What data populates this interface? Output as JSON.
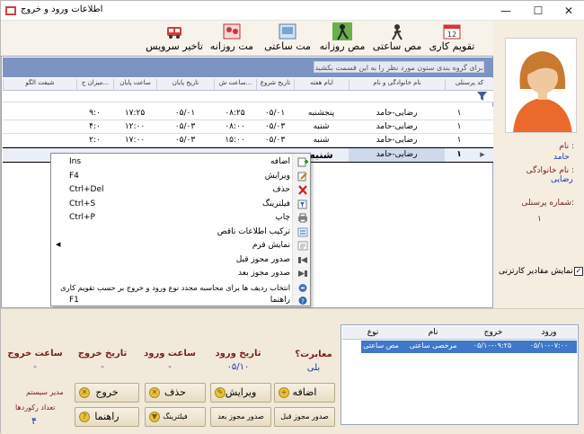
{
  "window": {
    "title": "اطلاعات ورود و خروج",
    "controls": [
      "—",
      "☐",
      "✕"
    ]
  },
  "toolbar": [
    {
      "label": "تقویم کاری",
      "icon": "calendar-icon"
    },
    {
      "label": "مص ساعتی",
      "icon": "hourly-leave-icon"
    },
    {
      "label": "مص روزانه",
      "icon": "daily-leave-icon"
    },
    {
      "label": "مت ساعتی",
      "icon": "hourly-mission-icon"
    },
    {
      "label": "مت روزانه",
      "icon": "daily-mission-icon"
    },
    {
      "label": "تاخیر سرویس",
      "icon": "service-delay-icon"
    }
  ],
  "grid": {
    "group_hint": "برای گروه بندی ستون مورد نظر را به این قسمت بکشید",
    "columns": [
      "کد پرسنلی",
      "نام خانوادگی و نام",
      "ایام هفته",
      "تاریخ شروع",
      "ساعت ش...",
      "تاریخ پایان",
      "ساعت پایان",
      "میزان ج...",
      "شیفت الگو"
    ],
    "rows": [
      [
        "۱",
        "رضایی-حامد",
        "پنجشنبه",
        "۰۵/۰۱",
        "۰۸:۲۵",
        "۰۵/۰۱",
        "۱۷:۲۵",
        "۹:۰",
        ""
      ],
      [
        "۱",
        "رضایی-حامد",
        "شنبه",
        "۰۵/۰۳",
        "۰۸:۰۰",
        "۰۵/۰۳",
        "۱۲:۰۰",
        "۴:۰",
        ""
      ],
      [
        "۱",
        "رضایی-حامد",
        "شنبه",
        "۰۵/۰۳",
        "۱۵:۰۰",
        "۰۵/۰۳",
        "۱۷:۰۰",
        "۲:۰",
        ""
      ],
      [
        "۱",
        "رضایی-حامد",
        "شنبه",
        "",
        "",
        "",
        "",
        "",
        ""
      ]
    ]
  },
  "context_menu": [
    {
      "label": "اضافه",
      "key": "Ins",
      "icon": "add-icon"
    },
    {
      "label": "ویرایش",
      "key": "F4",
      "icon": "edit-icon"
    },
    {
      "label": "حذف",
      "key": "Ctrl+Del",
      "icon": "delete-icon"
    },
    {
      "label": "فیلترینگ",
      "key": "Ctrl+S",
      "icon": "filter-icon"
    },
    {
      "label": "چاپ",
      "key": "Ctrl+P",
      "icon": "print-icon"
    },
    {
      "label": "ترکیب اطلاعات ناقص",
      "key": "",
      "icon": "merge-icon"
    },
    {
      "label": "نمایش فرم",
      "key": "",
      "icon": "form-icon"
    },
    {
      "label": "صدور مجوز قبل",
      "key": "",
      "icon": "prev-permit-icon"
    },
    {
      "label": "صدور مجوز بعد",
      "key": "",
      "icon": "next-permit-icon"
    },
    {
      "label": "انتخاب ردیف ها برای محاسبه مجدد نوع ورود و خروج بر حسب تقویم کاری",
      "key": "",
      "icon": "recalc-icon"
    },
    {
      "label": "راهنما",
      "key": "F1",
      "icon": "help-icon"
    }
  ],
  "person": {
    "name_label": "نام :",
    "name": "حامد",
    "family_label": "نام خانوادگی :",
    "family": "رضایی",
    "code_label": "شماره پرسنلی:",
    "code": "۱",
    "show_char_label": "نمایش مقادیر کارتزنی",
    "show_char_checked": "✓"
  },
  "details": {
    "labels": [
      "معابرت؟",
      "تاریخ ورود",
      "ساعت ورود",
      "تاریخ خروج",
      "ساعت خروج"
    ],
    "values": [
      "بلی",
      "۰۵/۱۰",
      "-",
      "-",
      "-"
    ],
    "user": "مدیر سیستم",
    "record_count_label": "تعداد رکوردها",
    "record_count": "۴"
  },
  "buttons": {
    "add": "اضافه",
    "edit": "ویرایش",
    "delete": "حذف",
    "exit": "خروج",
    "help": "راهنما",
    "filter": "فیلترینگ",
    "next_permit": "صدور مجوز بعد",
    "prev_permit": "صدور مجوز قبل"
  },
  "mini_grid": {
    "columns": [
      "ورود",
      "خروج",
      "نام",
      "نوع"
    ],
    "row": [
      "۰۵/۱۰-۰۷:۰۰",
      "۰۵/۱۰-۰۹:۲۵",
      "مرخصی ساعتی",
      "مص ساعتی"
    ]
  }
}
